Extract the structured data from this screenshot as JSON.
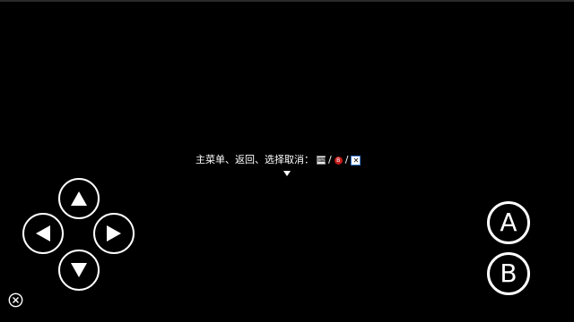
{
  "game": {
    "background": "#000000",
    "message": {
      "text": "主菜单、返回、选择取消：",
      "keys": [
        {
          "icon": "keyboard-key-icon",
          "label": "⌨"
        },
        {
          "icon": "red-b-button-icon",
          "label": "B"
        },
        {
          "icon": "x-key-icon",
          "label": "✕"
        }
      ],
      "separator": "/"
    }
  },
  "controls": {
    "dpad": {
      "up_icon": "triangle-up-icon",
      "down_icon": "triangle-down-icon",
      "left_icon": "triangle-left-icon",
      "right_icon": "triangle-right-icon"
    },
    "a_button": {
      "label": "A"
    },
    "b_button": {
      "label": "B"
    },
    "close_icon": "close-circle-icon"
  }
}
